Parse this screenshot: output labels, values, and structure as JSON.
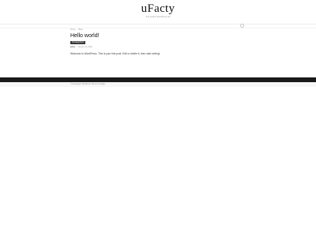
{
  "site": {
    "title": "uFacty",
    "tagline": "Just another WordPress site"
  },
  "breadcrumb": [
    "Home",
    "Blog"
  ],
  "post": {
    "title": "Hello world!",
    "category": "Uncategorized",
    "author": "admin",
    "date": "January 10, 2024",
    "excerpt": "Welcome to WordPress. This is your first post. Edit or delete it, then start writing!"
  },
  "footer": {
    "text": "© Newspaper WordPress Theme by TagDiv"
  }
}
